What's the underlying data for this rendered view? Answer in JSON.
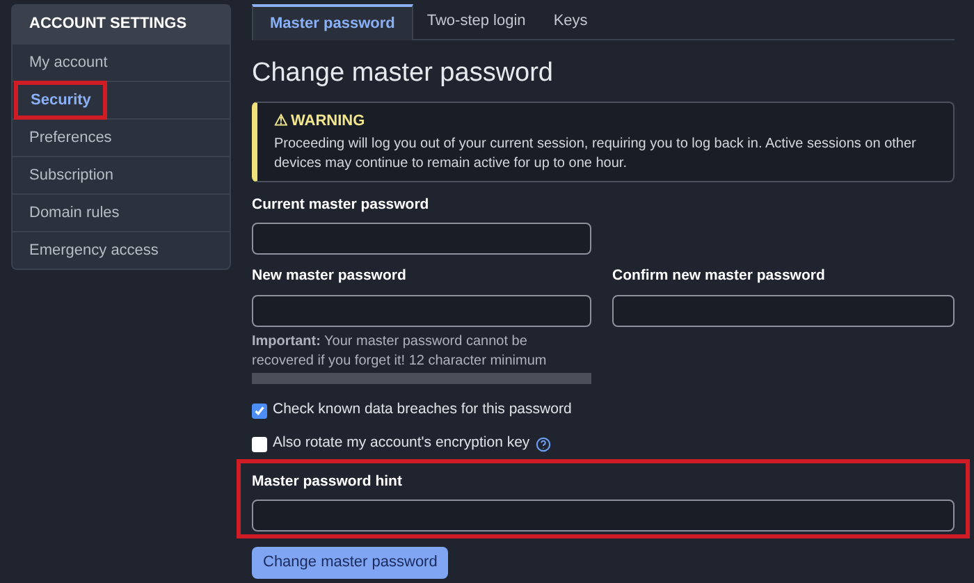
{
  "sidebar": {
    "heading": "ACCOUNT SETTINGS",
    "items": [
      {
        "label": "My account",
        "selected": false,
        "highlighted": false
      },
      {
        "label": "Security",
        "selected": true,
        "highlighted": true
      },
      {
        "label": "Preferences",
        "selected": false,
        "highlighted": false
      },
      {
        "label": "Subscription",
        "selected": false,
        "highlighted": false
      },
      {
        "label": "Domain rules",
        "selected": false,
        "highlighted": false
      },
      {
        "label": "Emergency access",
        "selected": false,
        "highlighted": false
      }
    ]
  },
  "tabs": [
    {
      "label": "Master password",
      "selected": true
    },
    {
      "label": "Two-step login",
      "selected": false
    },
    {
      "label": "Keys",
      "selected": false
    }
  ],
  "title": "Change master password",
  "warning": {
    "icon": "⚠",
    "heading": "WARNING",
    "text": "Proceeding will log you out of your current session, requiring you to log back in. Active sessions on other devices may continue to remain active for up to one hour."
  },
  "current_password": {
    "label": "Current master password"
  },
  "new_password": {
    "label": "New master password"
  },
  "confirm_password": {
    "label": "Confirm new master password"
  },
  "note": "**Important:** Your master password cannot be recovered if you forget it! 12 character minimum",
  "strength_meter": {
    "level": 0
  },
  "checkboxes": [
    {
      "label": "Check known data breaches for this password",
      "checked": true,
      "help": false
    },
    {
      "label": "Also rotate my account's encryption key",
      "checked": false,
      "help": true
    }
  ],
  "hint": {
    "label": "Master password hint",
    "highlighted": true
  },
  "submit": "Change master password"
}
